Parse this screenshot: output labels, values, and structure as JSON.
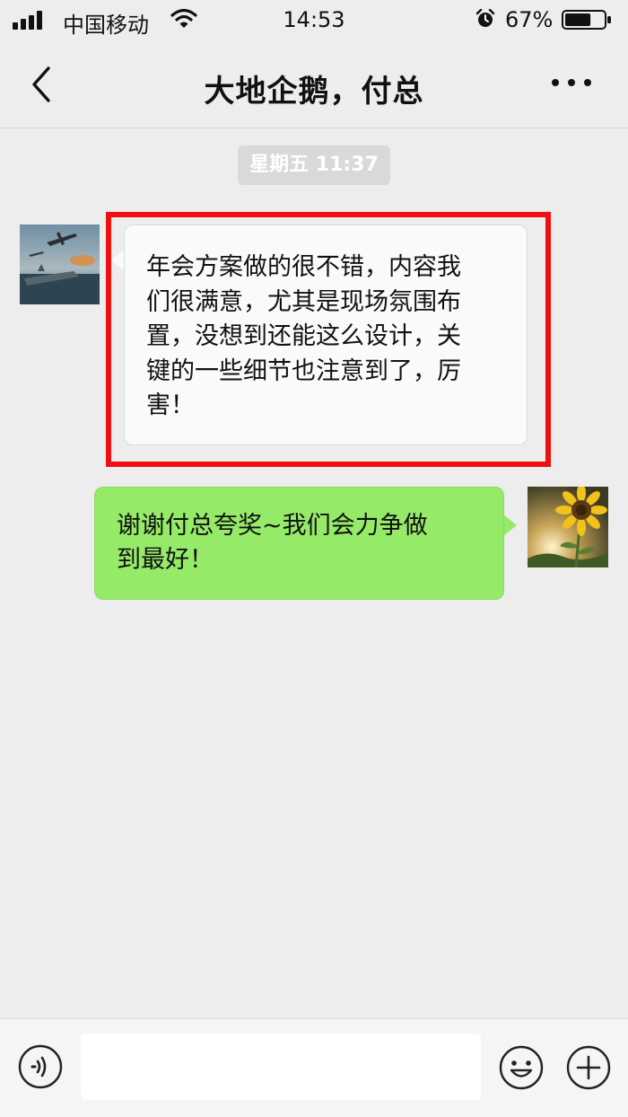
{
  "status_bar": {
    "carrier": "中国移动",
    "time": "14:53",
    "battery_percent": "67%",
    "signal_icon": "signal-bars-icon",
    "wifi_icon": "wifi-icon",
    "alarm_icon": "alarm-clock-icon",
    "battery_icon": "battery-icon",
    "battery_level": 0.67
  },
  "nav": {
    "title": "大地企鹅，付总",
    "back_icon": "chevron-left-icon",
    "more_icon": "more-dots-icon"
  },
  "chat": {
    "timestamp": "星期五 11:37",
    "messages": [
      {
        "side": "left",
        "avatar": "warplane-avatar",
        "lines": [
          "年会方案做的很不错，内容我",
          "们很满意，尤其是现场氛围布",
          "置，没想到还能这么设计，关",
          "键的一些细节也注意到了，厉",
          "害！"
        ],
        "highlighted": true,
        "highlight_color": "#f00f0f"
      },
      {
        "side": "right",
        "avatar": "sunflower-avatar",
        "lines": [
          "谢谢付总夸奖~我们会力争做",
          "到最好！"
        ],
        "bubble_color": "#95ea68"
      }
    ]
  },
  "input_bar": {
    "text_value": "",
    "voice_icon": "voice-icon",
    "emoji_icon": "emoji-icon",
    "plus_icon": "plus-icon"
  }
}
